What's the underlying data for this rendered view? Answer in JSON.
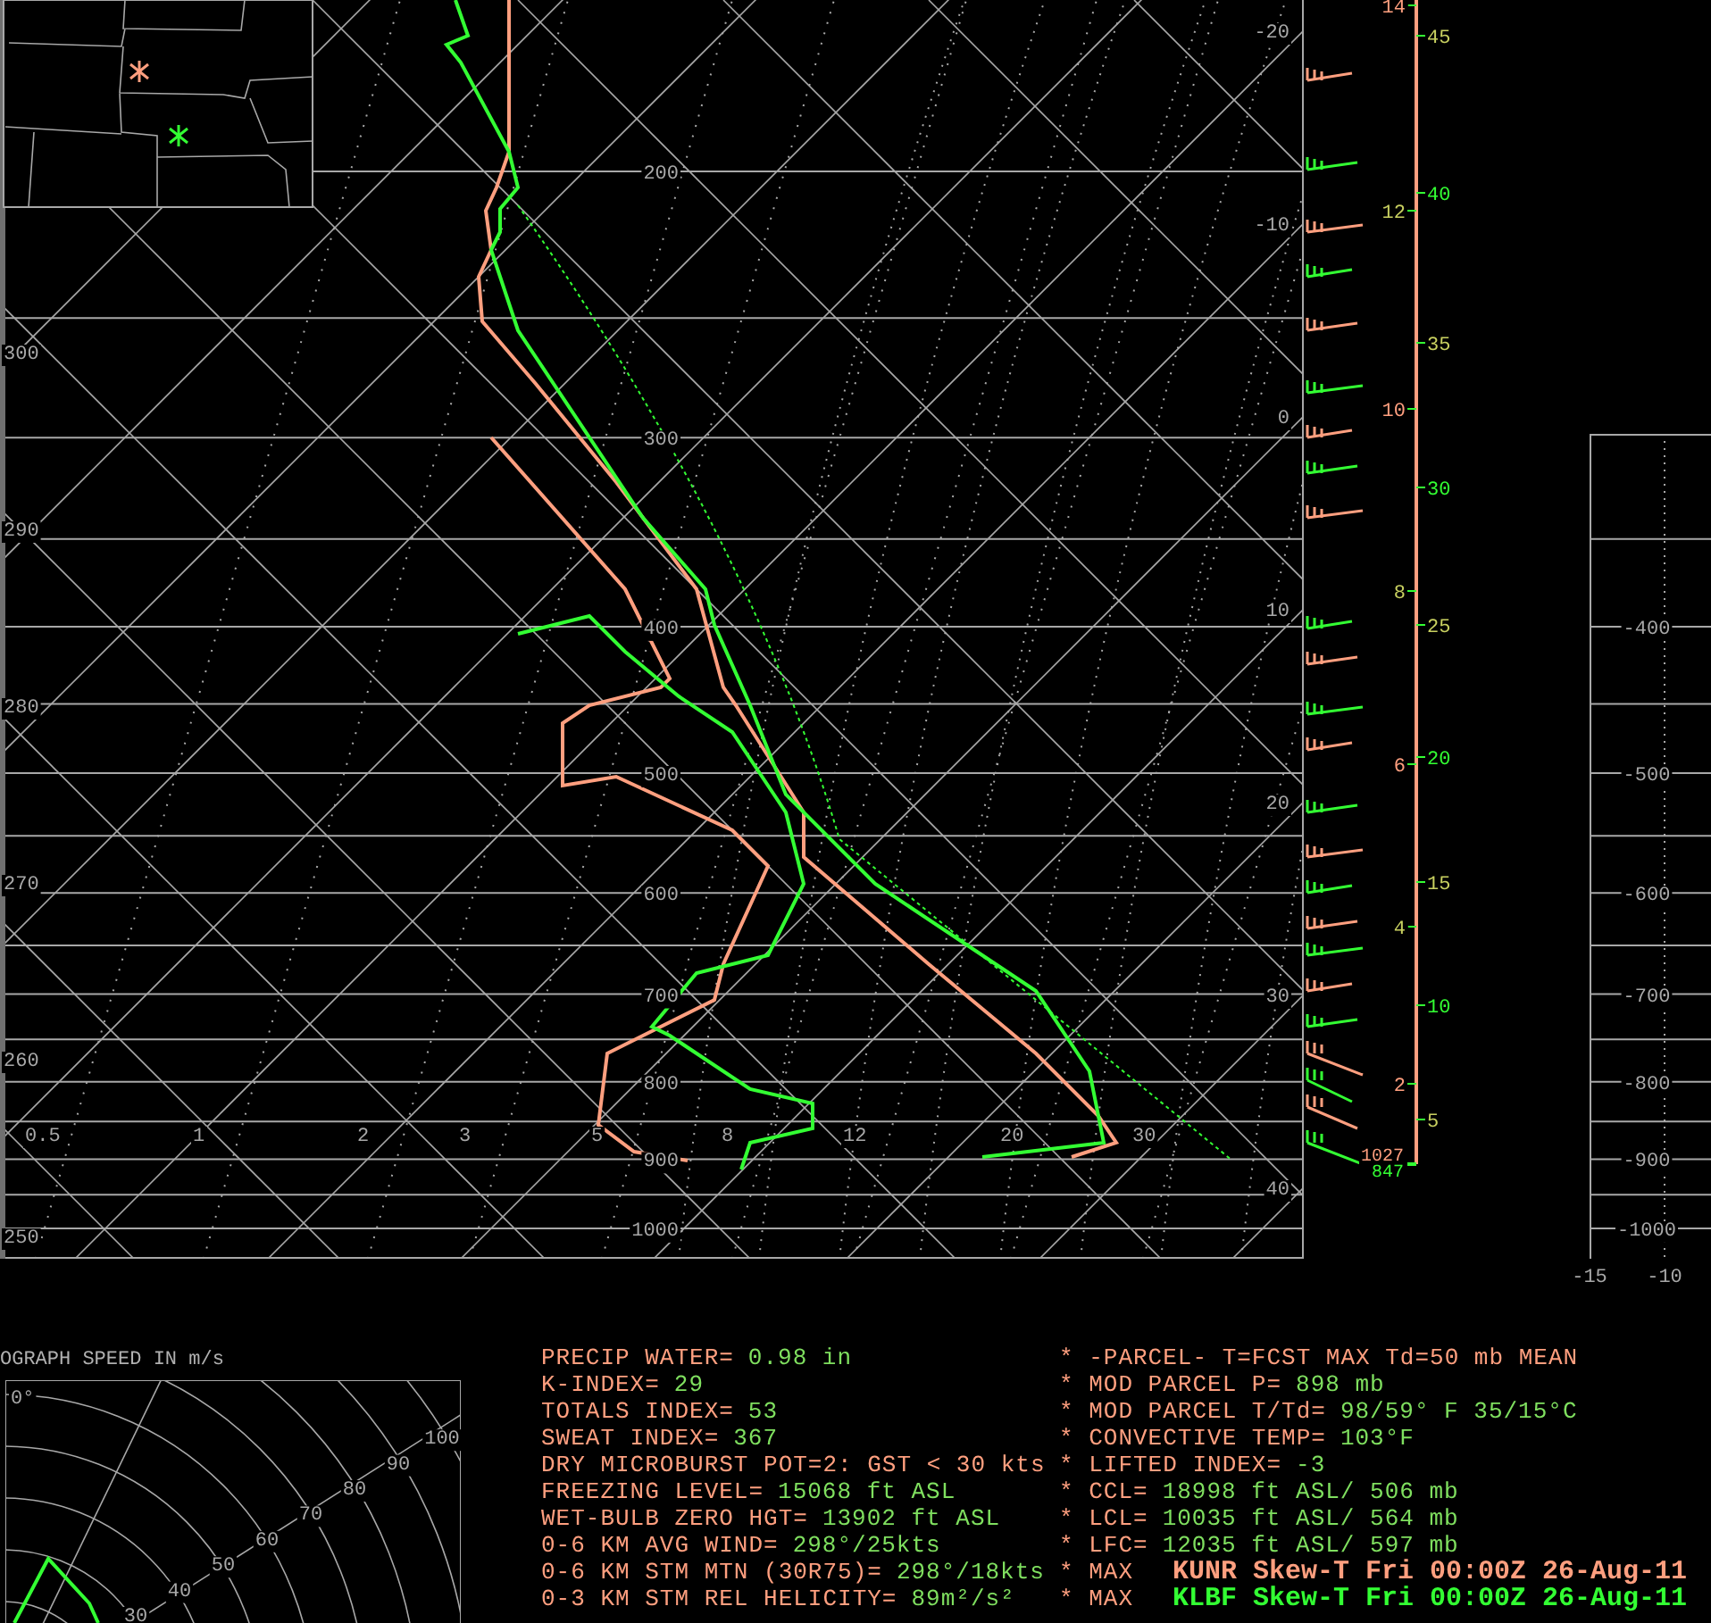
{
  "inset_map": {
    "stations": [
      {
        "color": "#ff9f7f"
      },
      {
        "color": "#33ff33"
      }
    ]
  },
  "skewt": {
    "pressure_labels": [
      "200",
      "300",
      "400",
      "500",
      "600",
      "700",
      "800",
      "900",
      "1000"
    ],
    "temperature_labels": [
      "-20",
      "-10",
      "0",
      "10",
      "20",
      "30",
      "40"
    ],
    "mixing_ratio_labels": [
      "0.5",
      "1",
      "2",
      "3",
      "5",
      "8",
      "12",
      "20",
      "30"
    ],
    "theta_labels": [
      "300",
      "290",
      "280",
      "270",
      "260",
      "250"
    ]
  },
  "height_scale": {
    "km_labels": [
      "14",
      "12",
      "10",
      "8",
      "6",
      "4",
      "2"
    ],
    "kft_labels": [
      "45",
      "40",
      "35",
      "30",
      "25",
      "20",
      "15",
      "10",
      "5"
    ],
    "surface_labels": [
      "1027",
      "847"
    ]
  },
  "side_panel": {
    "pressure_labels": [
      "-400",
      "-500",
      "-600",
      "-700",
      "-800",
      "-900",
      "-1000"
    ],
    "x_labels": [
      "-15",
      "-10"
    ]
  },
  "hodograph": {
    "title": "OGRAPH SPEED IN m/s",
    "direction_label": "0°",
    "speed_labels": [
      "30",
      "40",
      "50",
      "60",
      "70",
      "80",
      "90",
      "100"
    ]
  },
  "indices_left": [
    {
      "label": "PRECIP WATER=",
      "value": "0.98 in"
    },
    {
      "label": "K-INDEX=",
      "value": "29"
    },
    {
      "label": "TOTALS INDEX=",
      "value": "53"
    },
    {
      "label": "SWEAT INDEX=",
      "value": "367"
    },
    {
      "label": "DRY MICROBURST POT=2: GST < 30 kts"
    },
    {
      "label": "FREEZING LEVEL=",
      "value": "15068 ft ASL"
    },
    {
      "label": "WET-BULB ZERO HGT=",
      "value": "13902 ft ASL"
    },
    {
      "label": "0-6 KM AVG WIND=",
      "value": "298°/25kts"
    },
    {
      "label": "0-6 KM STM MTN (30R75)=",
      "value": "298°/18kts"
    },
    {
      "label": "0-3 KM STM REL HELICITY=",
      "value": "89m²/s²"
    }
  ],
  "indices_right": [
    {
      "label": "* -PARCEL- T=FCST MAX Td=50 mb MEAN"
    },
    {
      "label": "* MOD PARCEL P=",
      "value": "898 mb"
    },
    {
      "label": "* MOD PARCEL T/Td=",
      "value": "98/59° F 35/15°C"
    },
    {
      "label": "* CONVECTIVE TEMP=",
      "value": "103°F"
    },
    {
      "label": "* LIFTED INDEX=",
      "value": "-3"
    },
    {
      "label": "* CCL=",
      "value": "18998 ft ASL/ 506 mb"
    },
    {
      "label": "* LCL=",
      "value": "10035 ft ASL/ 564 mb"
    },
    {
      "label": "* LFC=",
      "value": "12035 ft ASL/ 597 mb"
    },
    {
      "label": "* MAX"
    },
    {
      "label": "* MAX"
    }
  ],
  "titles": [
    {
      "text": "KUNR Skew-T Fri 00:00Z 26-Aug-11",
      "color": "#ff9f7f"
    },
    {
      "text": "KLBF Skew-T Fri 00:00Z 26-Aug-11",
      "color": "#33ff33"
    }
  ]
}
